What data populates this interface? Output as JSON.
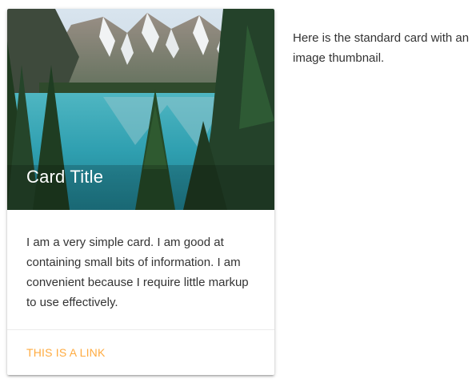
{
  "card": {
    "title": "Card Title",
    "content": "I am a very simple card. I am good at containing small bits of information. I am convenient because I require little markup to use effectively.",
    "action_link": "This is a link",
    "image_icon": "lake-mountain-photo",
    "link_color": "#ffab40"
  },
  "side_text": "Here is the standard card with an image thumbnail."
}
